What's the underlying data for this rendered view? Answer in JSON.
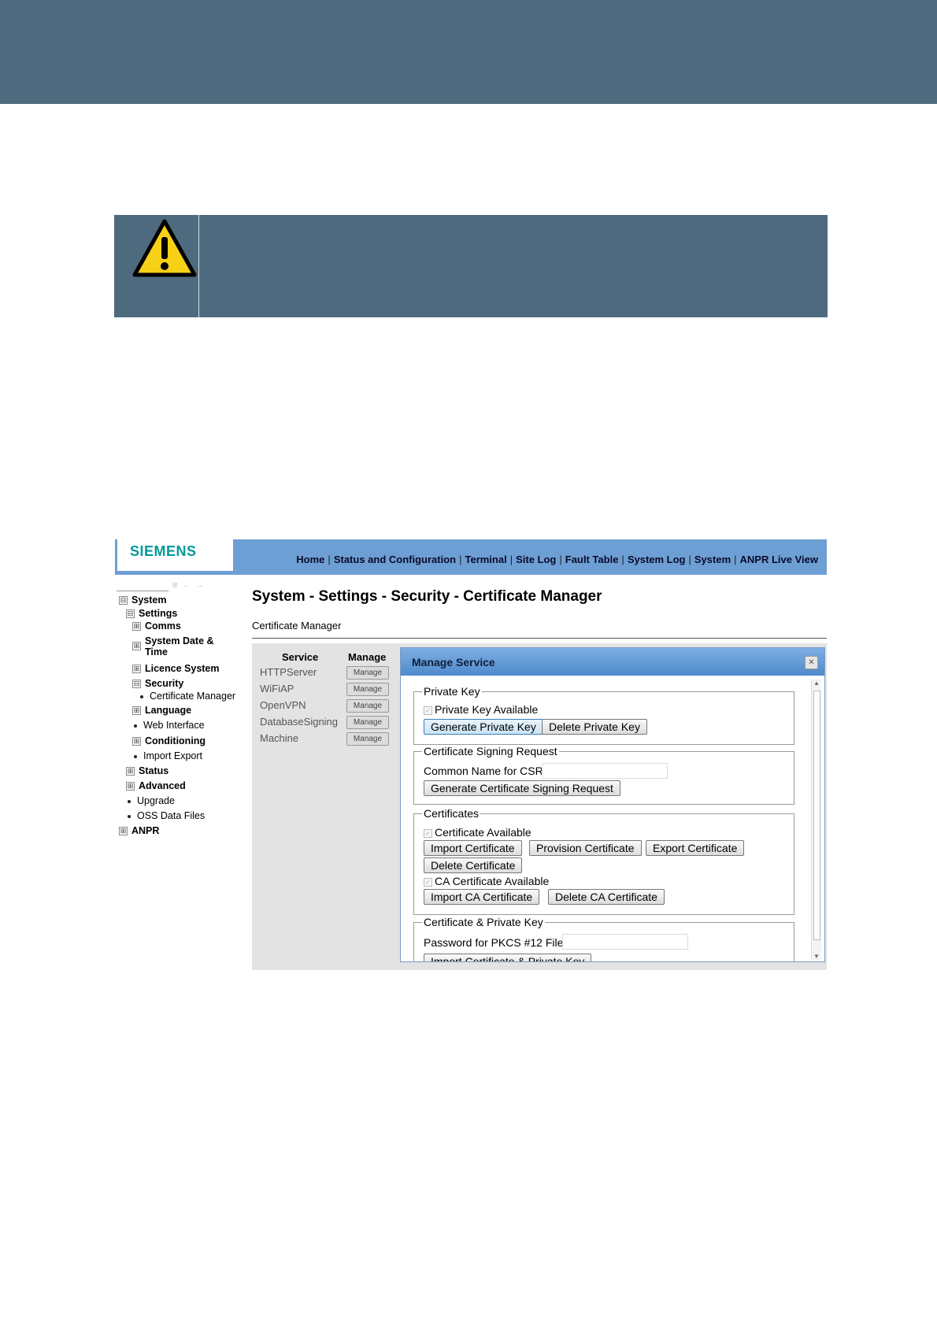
{
  "figure": {
    "logo": "SIEMENS",
    "topnav": [
      "Home",
      "Status and Configuration",
      "Terminal",
      "Site Log",
      "Fault Table",
      "System Log",
      "System",
      "ANPR Live View"
    ],
    "topnav_separator": "|",
    "sidebar": {
      "items": [
        {
          "label": "System",
          "toggle": "⊟"
        },
        {
          "label": "Settings",
          "toggle": "⊟"
        },
        {
          "label": "Comms",
          "toggle": "⊞"
        },
        {
          "label": "System Date &",
          "label2": "Time",
          "toggle": "⊞"
        },
        {
          "label": "Licence System",
          "toggle": "⊞"
        },
        {
          "label": "Security",
          "toggle": "⊟"
        },
        {
          "label": "Certificate Manager"
        },
        {
          "label": "Language",
          "toggle": "⊞"
        },
        {
          "label": "Web Interface"
        },
        {
          "label": "Conditioning",
          "toggle": "⊞"
        },
        {
          "label": "Import Export"
        },
        {
          "label": "Status",
          "toggle": "⊞"
        },
        {
          "label": "Advanced",
          "toggle": "⊞"
        },
        {
          "label": "Upgrade"
        },
        {
          "label": "OSS Data Files"
        },
        {
          "label": "ANPR",
          "toggle": "⊞"
        }
      ]
    },
    "page_title": "System - Settings - Security - Certificate Manager",
    "subtitle": "Certificate Manager",
    "services_table": {
      "headers": [
        "Service",
        "Manage"
      ],
      "rows": [
        "HTTPServer",
        "WiFiAP",
        "OpenVPN",
        "DatabaseSigning",
        "Machine"
      ],
      "manage_label": "Manage"
    },
    "dialog": {
      "title": "Manage Service",
      "close_glyph": "✕",
      "private_key": {
        "legend": "Private Key",
        "checkbox": "Private Key Available",
        "generate": "Generate Private Key",
        "delete": "Delete Private Key"
      },
      "csr": {
        "legend": "Certificate Signing Request",
        "field_label": "Common Name for CSR",
        "generate": "Generate Certificate Signing Request"
      },
      "certificates": {
        "legend": "Certificates",
        "checkbox": "Certificate Available",
        "import": "Import Certificate",
        "provision": "Provision Certificate",
        "export": "Export Certificate",
        "delete": "Delete Certificate",
        "ca_checkbox": "CA Certificate Available",
        "import_ca": "Import CA Certificate",
        "delete_ca": "Delete CA Certificate"
      },
      "cert_key": {
        "legend": "Certificate & Private Key",
        "field_label": "Password for PKCS #12 File",
        "import": "Import Certificate & Private Key"
      }
    }
  },
  "colors": {
    "band": "#4e6a7e",
    "header_blue": "#6d9fd4",
    "siemens_teal": "#009999",
    "warning_yellow": "#f7d117"
  }
}
